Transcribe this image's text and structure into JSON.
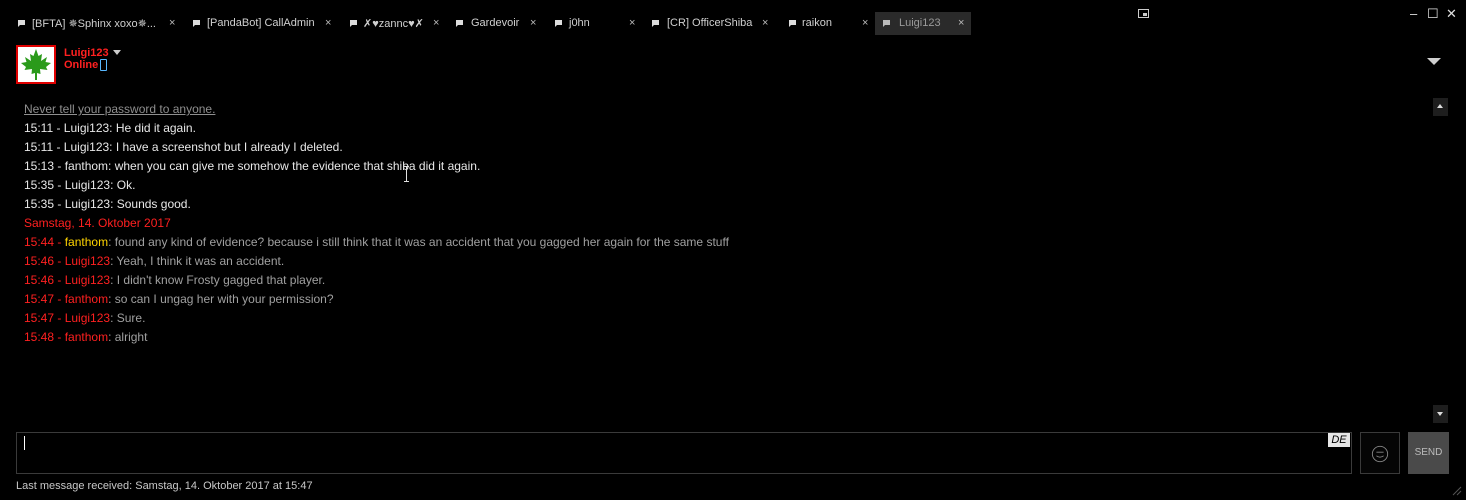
{
  "tabs": [
    {
      "label": "[BFTA] ✵Sphinx xoxo✵...",
      "close": "×"
    },
    {
      "label": "[PandaBot] CallAdmin",
      "close": "×"
    },
    {
      "label": "✗♥zannc♥✗",
      "close": "×"
    },
    {
      "label": "Gardevoir",
      "close": "×"
    },
    {
      "label": "j0hn",
      "close": "×"
    },
    {
      "label": "[CR] OfficerShiba",
      "close": "×"
    },
    {
      "label": "raikon",
      "close": "×"
    },
    {
      "label": "Luigi123",
      "close": "×",
      "active": true
    }
  ],
  "window": {
    "minimize": "–",
    "maximize": "☐",
    "close": "✕"
  },
  "header": {
    "username": "Luigi123",
    "status": "Online"
  },
  "chat": {
    "notice": "Never tell your password to anyone.",
    "history": [
      "15:11 - Luigi123: He did it again.",
      "15:11 - Luigi123: I have a screenshot but I already I deleted.",
      "15:13 - fanthom: when you can give me somehow the evidence that shiba did it again.",
      "15:35 - Luigi123: Ok.",
      "15:35 - Luigi123: Sounds good."
    ],
    "date_separator": "Samstag, 14. Oktober 2017",
    "messages": [
      {
        "prefix": "15:44 - ",
        "sender": "fanthom",
        "highlight": true,
        "text": ": found any kind of evidence? because i still think that it was an accident that you gagged her again for the same stuff"
      },
      {
        "prefix": "15:46 - ",
        "sender": "Luigi123",
        "highlight": false,
        "text": ": Yeah, I think it was an accident."
      },
      {
        "prefix": "15:46 - ",
        "sender": "Luigi123",
        "highlight": false,
        "text": ": I didn't know Frosty gagged that player."
      },
      {
        "prefix": "15:47 - ",
        "sender": "fanthom",
        "highlight": false,
        "text": ": so can I ungag her with your permission?"
      },
      {
        "prefix": "15:47 - ",
        "sender": "Luigi123",
        "highlight": false,
        "text": ": Sure."
      },
      {
        "prefix": "15:48 - ",
        "sender": "fanthom",
        "highlight": false,
        "text": ": alright"
      }
    ]
  },
  "input": {
    "value": "",
    "language": "DE"
  },
  "send_label": "SEND",
  "footer": {
    "last_message": "Last message received: Samstag, 14. Oktober 2017 at 15:47"
  },
  "colors": {
    "accent_red": "#ff2020",
    "highlight_yellow": "#ffd400",
    "background": "#000000"
  }
}
